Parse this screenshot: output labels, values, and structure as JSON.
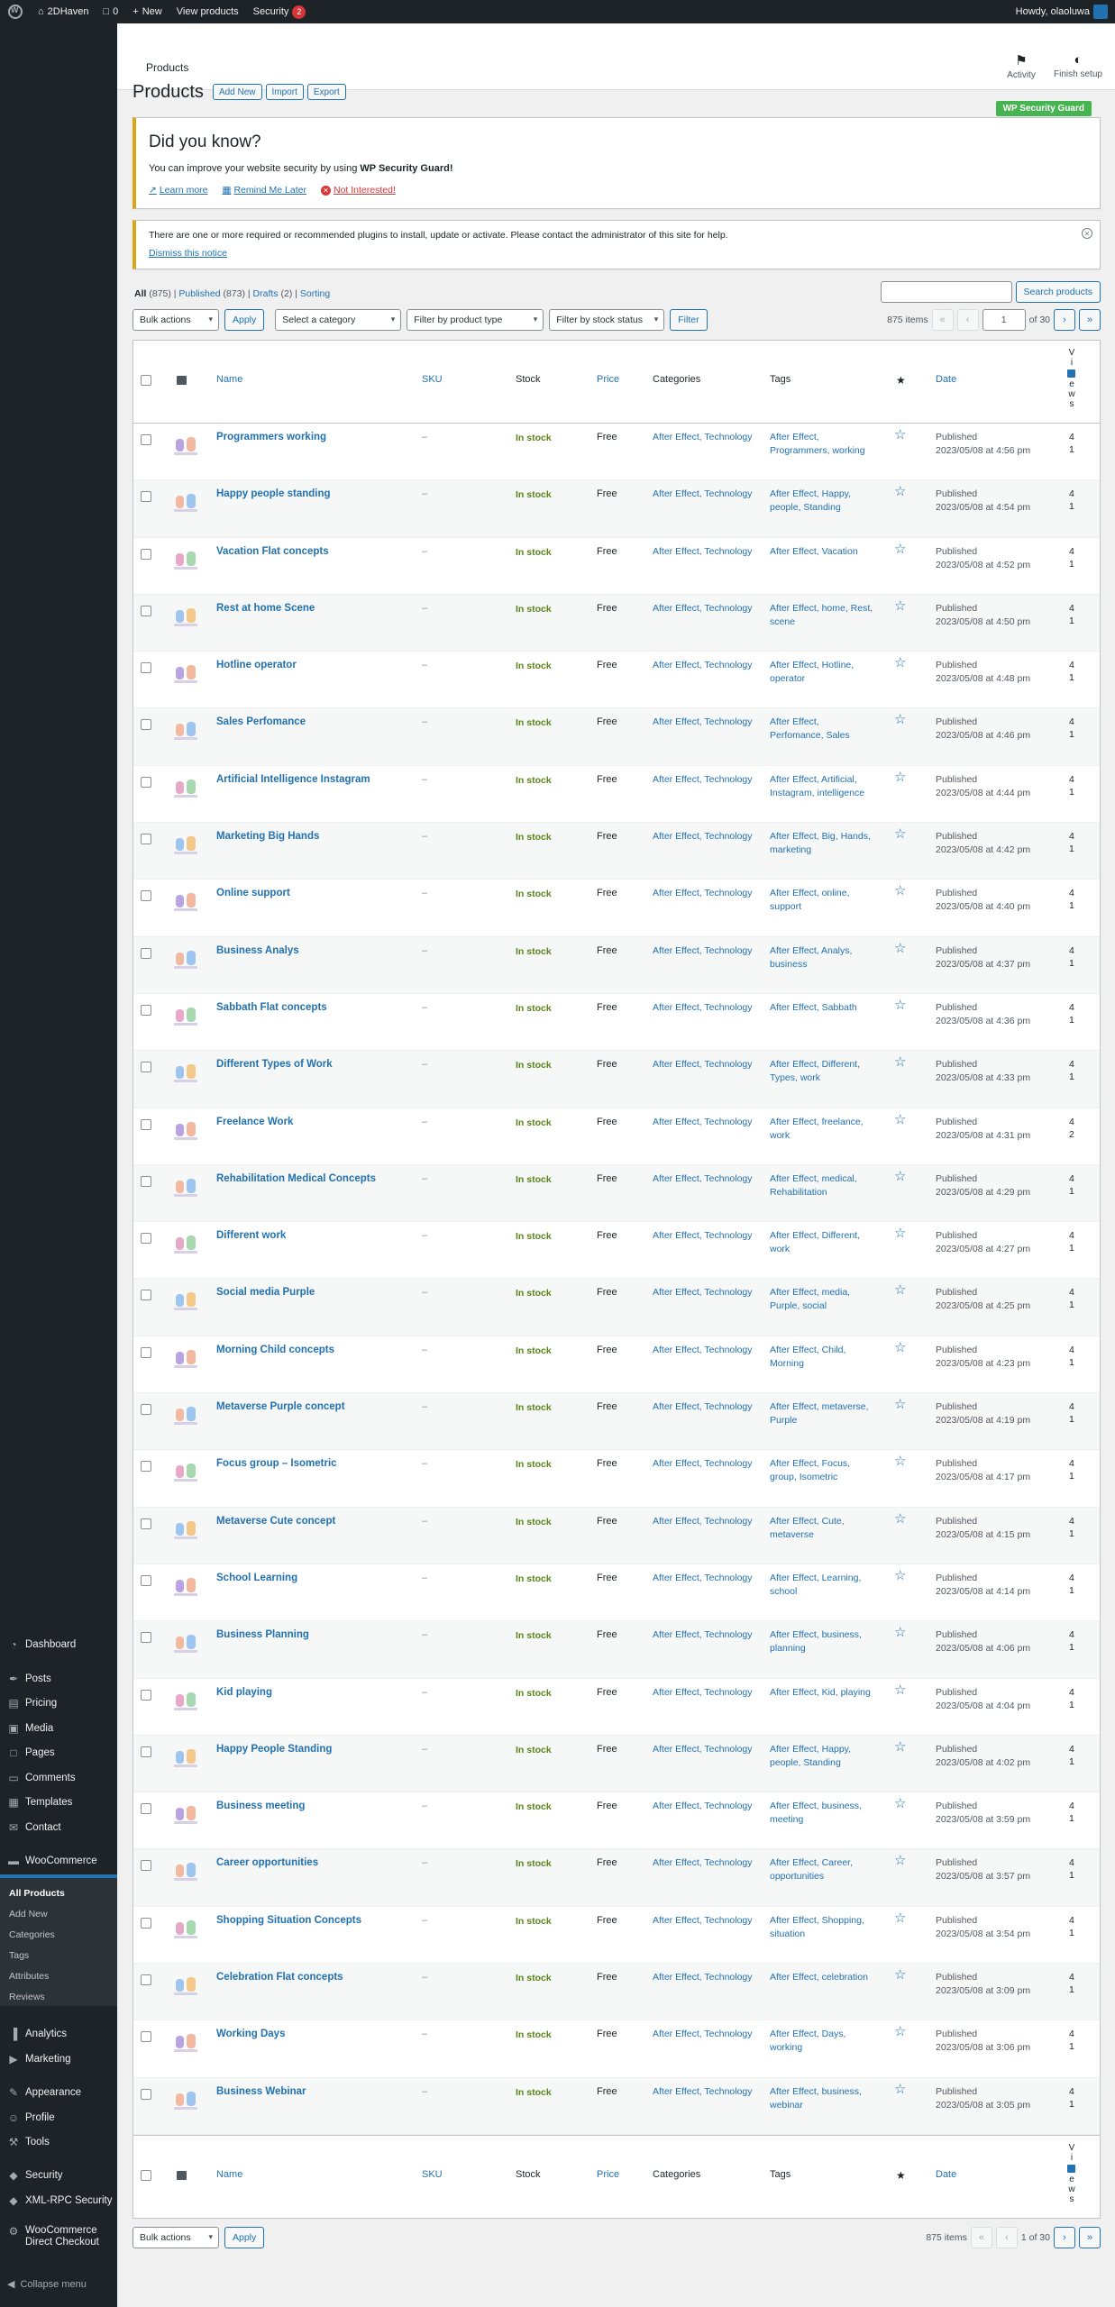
{
  "adminbar": {
    "site_name": "2DHaven",
    "comments_count": "0",
    "new_label": "New",
    "view_products_label": "View products",
    "security_label": "Security",
    "security_count": "2",
    "howdy": "Howdy, olaoluwa"
  },
  "sidebar": {
    "items": [
      {
        "label": "Dashboard",
        "icon": "dashboard-icon"
      },
      {
        "label": "Posts",
        "icon": "pin-icon"
      },
      {
        "label": "Pricing",
        "icon": "pricing-icon"
      },
      {
        "label": "Media",
        "icon": "media-icon"
      },
      {
        "label": "Pages",
        "icon": "pages-icon"
      },
      {
        "label": "Comments",
        "icon": "comment-icon"
      },
      {
        "label": "Templates",
        "icon": "templates-icon"
      },
      {
        "label": "Contact",
        "icon": "mail-icon"
      },
      {
        "label": "WooCommerce",
        "icon": "woo-icon"
      },
      {
        "label": "Products",
        "icon": "archive-icon"
      },
      {
        "label": "Analytics",
        "icon": "chart-icon"
      },
      {
        "label": "Marketing",
        "icon": "megaphone-icon"
      },
      {
        "label": "Appearance",
        "icon": "brush-icon"
      },
      {
        "label": "Profile",
        "icon": "user-icon"
      },
      {
        "label": "Tools",
        "icon": "wrench-icon"
      },
      {
        "label": "Security",
        "icon": "shield-icon"
      },
      {
        "label": "XML-RPC Security",
        "icon": "shield-icon"
      },
      {
        "label": "WooCommerce Direct Checkout",
        "icon": "gear-icon"
      }
    ],
    "submenu": [
      "All Products",
      "Add New",
      "Categories",
      "Tags",
      "Attributes",
      "Reviews"
    ],
    "collapse_label": "Collapse menu"
  },
  "header": {
    "title": "Products",
    "activity_label": "Activity",
    "finish_setup_label": "Finish setup"
  },
  "page": {
    "title": "Products",
    "add_new": "Add New",
    "import": "Import",
    "export": "Export",
    "security_badge": "WP Security Guard"
  },
  "notice1": {
    "heading": "Did you know?",
    "text_prefix": "You can improve your website security by using ",
    "text_bold": "WP Security Guard!",
    "learn_more": "Learn more",
    "remind_later": "Remind Me Later",
    "not_interested": "Not Interested!"
  },
  "notice2": {
    "text": "There are one or more required or recommended plugins to install, update or activate. Please contact the administrator of this site for help.",
    "dismiss": "Dismiss this notice"
  },
  "filters": {
    "all": "All",
    "all_count": "(875)",
    "published": "Published",
    "published_count": "(873)",
    "drafts": "Drafts",
    "drafts_count": "(2)",
    "sorting": "Sorting",
    "search_button": "Search products",
    "bulk_actions": "Bulk actions",
    "apply": "Apply",
    "category": "Select a category",
    "product_type": "Filter by product type",
    "stock_status": "Filter by stock status",
    "filter_button": "Filter",
    "items_count": "875 items",
    "current_page": "1",
    "of_pages": "of 30",
    "bottom_pages": "1 of 30"
  },
  "columns": {
    "name": "Name",
    "sku": "SKU",
    "stock": "Stock",
    "price": "Price",
    "categories": "Categories",
    "tags": "Tags",
    "date": "Date",
    "views_letters": [
      "V",
      "i",
      "e",
      "w",
      "s"
    ]
  },
  "products": [
    {
      "name": "Programmers working",
      "sku": "–",
      "stock": "In stock",
      "price": "Free",
      "cats": "After Effect, Technology",
      "tags1": "After Effect,",
      "tags2": "Programmers, working",
      "status": "Published",
      "date": "2023/05/08 at 4:56 pm",
      "v1": "4",
      "v2": "1"
    },
    {
      "name": "Happy people standing",
      "sku": "–",
      "stock": "In stock",
      "price": "Free",
      "cats": "After Effect, Technology",
      "tags1": "After Effect, Happy,",
      "tags2": "people, Standing",
      "status": "Published",
      "date": "2023/05/08 at 4:54 pm",
      "v1": "4",
      "v2": "1"
    },
    {
      "name": "Vacation Flat concepts",
      "sku": "–",
      "stock": "In stock",
      "price": "Free",
      "cats": "After Effect, Technology",
      "tags1": "After Effect, Vacation",
      "tags2": "",
      "status": "Published",
      "date": "2023/05/08 at 4:52 pm",
      "v1": "4",
      "v2": "1"
    },
    {
      "name": "Rest at home Scene",
      "sku": "–",
      "stock": "In stock",
      "price": "Free",
      "cats": "After Effect, Technology",
      "tags1": "After Effect, home, Rest,",
      "tags2": "scene",
      "status": "Published",
      "date": "2023/05/08 at 4:50 pm",
      "v1": "4",
      "v2": "1"
    },
    {
      "name": "Hotline operator",
      "sku": "–",
      "stock": "In stock",
      "price": "Free",
      "cats": "After Effect, Technology",
      "tags1": "After Effect, Hotline,",
      "tags2": "operator",
      "status": "Published",
      "date": "2023/05/08 at 4:48 pm",
      "v1": "4",
      "v2": "1"
    },
    {
      "name": "Sales Perfomance",
      "sku": "–",
      "stock": "In stock",
      "price": "Free",
      "cats": "After Effect, Technology",
      "tags1": "After Effect,",
      "tags2": "Perfomance, Sales",
      "status": "Published",
      "date": "2023/05/08 at 4:46 pm",
      "v1": "4",
      "v2": "1"
    },
    {
      "name": "Artificial Intelligence Instagram",
      "sku": "–",
      "stock": "In stock",
      "price": "Free",
      "cats": "After Effect, Technology",
      "tags1": "After Effect, Artificial,",
      "tags2": "Instagram, intelligence",
      "status": "Published",
      "date": "2023/05/08 at 4:44 pm",
      "v1": "4",
      "v2": "1"
    },
    {
      "name": "Marketing Big Hands",
      "sku": "–",
      "stock": "In stock",
      "price": "Free",
      "cats": "After Effect, Technology",
      "tags1": "After Effect, Big, Hands,",
      "tags2": "marketing",
      "status": "Published",
      "date": "2023/05/08 at 4:42 pm",
      "v1": "4",
      "v2": "1"
    },
    {
      "name": "Online support",
      "sku": "–",
      "stock": "In stock",
      "price": "Free",
      "cats": "After Effect, Technology",
      "tags1": "After Effect, online,",
      "tags2": "support",
      "status": "Published",
      "date": "2023/05/08 at 4:40 pm",
      "v1": "4",
      "v2": "1"
    },
    {
      "name": "Business Analys",
      "sku": "–",
      "stock": "In stock",
      "price": "Free",
      "cats": "After Effect, Technology",
      "tags1": "After Effect, Analys,",
      "tags2": "business",
      "status": "Published",
      "date": "2023/05/08 at 4:37 pm",
      "v1": "4",
      "v2": "1"
    },
    {
      "name": "Sabbath Flat concepts",
      "sku": "–",
      "stock": "In stock",
      "price": "Free",
      "cats": "After Effect, Technology",
      "tags1": "After Effect, Sabbath",
      "tags2": "",
      "status": "Published",
      "date": "2023/05/08 at 4:36 pm",
      "v1": "4",
      "v2": "1"
    },
    {
      "name": "Different Types of Work",
      "sku": "–",
      "stock": "In stock",
      "price": "Free",
      "cats": "After Effect, Technology",
      "tags1": "After Effect, Different,",
      "tags2": "Types, work",
      "status": "Published",
      "date": "2023/05/08 at 4:33 pm",
      "v1": "4",
      "v2": "1"
    },
    {
      "name": "Freelance Work",
      "sku": "–",
      "stock": "In stock",
      "price": "Free",
      "cats": "After Effect, Technology",
      "tags1": "After Effect, freelance,",
      "tags2": "work",
      "status": "Published",
      "date": "2023/05/08 at 4:31 pm",
      "v1": "4",
      "v2": "2"
    },
    {
      "name": "Rehabilitation Medical Concepts",
      "sku": "–",
      "stock": "In stock",
      "price": "Free",
      "cats": "After Effect, Technology",
      "tags1": "After Effect, medical,",
      "tags2": "Rehabilitation",
      "status": "Published",
      "date": "2023/05/08 at 4:29 pm",
      "v1": "4",
      "v2": "1"
    },
    {
      "name": "Different work",
      "sku": "–",
      "stock": "In stock",
      "price": "Free",
      "cats": "After Effect, Technology",
      "tags1": "After Effect, Different,",
      "tags2": "work",
      "status": "Published",
      "date": "2023/05/08 at 4:27 pm",
      "v1": "4",
      "v2": "1"
    },
    {
      "name": "Social media Purple",
      "sku": "–",
      "stock": "In stock",
      "price": "Free",
      "cats": "After Effect, Technology",
      "tags1": "After Effect, media,",
      "tags2": "Purple, social",
      "status": "Published",
      "date": "2023/05/08 at 4:25 pm",
      "v1": "4",
      "v2": "1"
    },
    {
      "name": "Morning Child concepts",
      "sku": "–",
      "stock": "In stock",
      "price": "Free",
      "cats": "After Effect, Technology",
      "tags1": "After Effect, Child,",
      "tags2": "Morning",
      "status": "Published",
      "date": "2023/05/08 at 4:23 pm",
      "v1": "4",
      "v2": "1"
    },
    {
      "name": "Metaverse Purple concept",
      "sku": "–",
      "stock": "In stock",
      "price": "Free",
      "cats": "After Effect, Technology",
      "tags1": "After Effect, metaverse,",
      "tags2": "Purple",
      "status": "Published",
      "date": "2023/05/08 at 4:19 pm",
      "v1": "4",
      "v2": "1"
    },
    {
      "name": "Focus group – Isometric",
      "sku": "–",
      "stock": "In stock",
      "price": "Free",
      "cats": "After Effect, Technology",
      "tags1": "After Effect, Focus,",
      "tags2": "group, Isometric",
      "status": "Published",
      "date": "2023/05/08 at 4:17 pm",
      "v1": "4",
      "v2": "1"
    },
    {
      "name": "Metaverse Cute concept",
      "sku": "–",
      "stock": "In stock",
      "price": "Free",
      "cats": "After Effect, Technology",
      "tags1": "After Effect, Cute,",
      "tags2": "metaverse",
      "status": "Published",
      "date": "2023/05/08 at 4:15 pm",
      "v1": "4",
      "v2": "1"
    },
    {
      "name": "School Learning",
      "sku": "–",
      "stock": "In stock",
      "price": "Free",
      "cats": "After Effect, Technology",
      "tags1": "After Effect, Learning,",
      "tags2": "school",
      "status": "Published",
      "date": "2023/05/08 at 4:14 pm",
      "v1": "4",
      "v2": "1"
    },
    {
      "name": "Business Planning",
      "sku": "–",
      "stock": "In stock",
      "price": "Free",
      "cats": "After Effect, Technology",
      "tags1": "After Effect, business,",
      "tags2": "planning",
      "status": "Published",
      "date": "2023/05/08 at 4:06 pm",
      "v1": "4",
      "v2": "1"
    },
    {
      "name": "Kid playing",
      "sku": "–",
      "stock": "In stock",
      "price": "Free",
      "cats": "After Effect, Technology",
      "tags1": "After Effect, Kid, playing",
      "tags2": "",
      "status": "Published",
      "date": "2023/05/08 at 4:04 pm",
      "v1": "4",
      "v2": "1"
    },
    {
      "name": "Happy People Standing",
      "sku": "–",
      "stock": "In stock",
      "price": "Free",
      "cats": "After Effect, Technology",
      "tags1": "After Effect, Happy,",
      "tags2": "people, Standing",
      "status": "Published",
      "date": "2023/05/08 at 4:02 pm",
      "v1": "4",
      "v2": "1"
    },
    {
      "name": "Business meeting",
      "sku": "–",
      "stock": "In stock",
      "price": "Free",
      "cats": "After Effect, Technology",
      "tags1": "After Effect, business,",
      "tags2": "meeting",
      "status": "Published",
      "date": "2023/05/08 at 3:59 pm",
      "v1": "4",
      "v2": "1"
    },
    {
      "name": "Career opportunities",
      "sku": "–",
      "stock": "In stock",
      "price": "Free",
      "cats": "After Effect, Technology",
      "tags1": "After Effect, Career,",
      "tags2": "opportunities",
      "status": "Published",
      "date": "2023/05/08 at 3:57 pm",
      "v1": "4",
      "v2": "1"
    },
    {
      "name": "Shopping Situation Concepts",
      "sku": "–",
      "stock": "In stock",
      "price": "Free",
      "cats": "After Effect, Technology",
      "tags1": "After Effect, Shopping,",
      "tags2": "situation",
      "status": "Published",
      "date": "2023/05/08 at 3:54 pm",
      "v1": "4",
      "v2": "1"
    },
    {
      "name": "Celebration Flat concepts",
      "sku": "–",
      "stock": "In stock",
      "price": "Free",
      "cats": "After Effect, Technology",
      "tags1": "After Effect, celebration",
      "tags2": "",
      "status": "Published",
      "date": "2023/05/08 at 3:09 pm",
      "v1": "4",
      "v2": "1"
    },
    {
      "name": "Working Days",
      "sku": "–",
      "stock": "In stock",
      "price": "Free",
      "cats": "After Effect, Technology",
      "tags1": "After Effect, Days,",
      "tags2": "working",
      "status": "Published",
      "date": "2023/05/08 at 3:06 pm",
      "v1": "4",
      "v2": "1"
    },
    {
      "name": "Business Webinar",
      "sku": "–",
      "stock": "In stock",
      "price": "Free",
      "cats": "After Effect, Technology",
      "tags1": "After Effect, business,",
      "tags2": "webinar",
      "status": "Published",
      "date": "2023/05/08 at 3:05 pm",
      "v1": "4",
      "v2": "1"
    }
  ],
  "colors": {
    "admin_bg": "#1d2327",
    "accent": "#2271b1",
    "in_stock": "#5b841b",
    "danger": "#d63638",
    "badge_green": "#46b450",
    "notice_yellow": "#dba617"
  }
}
